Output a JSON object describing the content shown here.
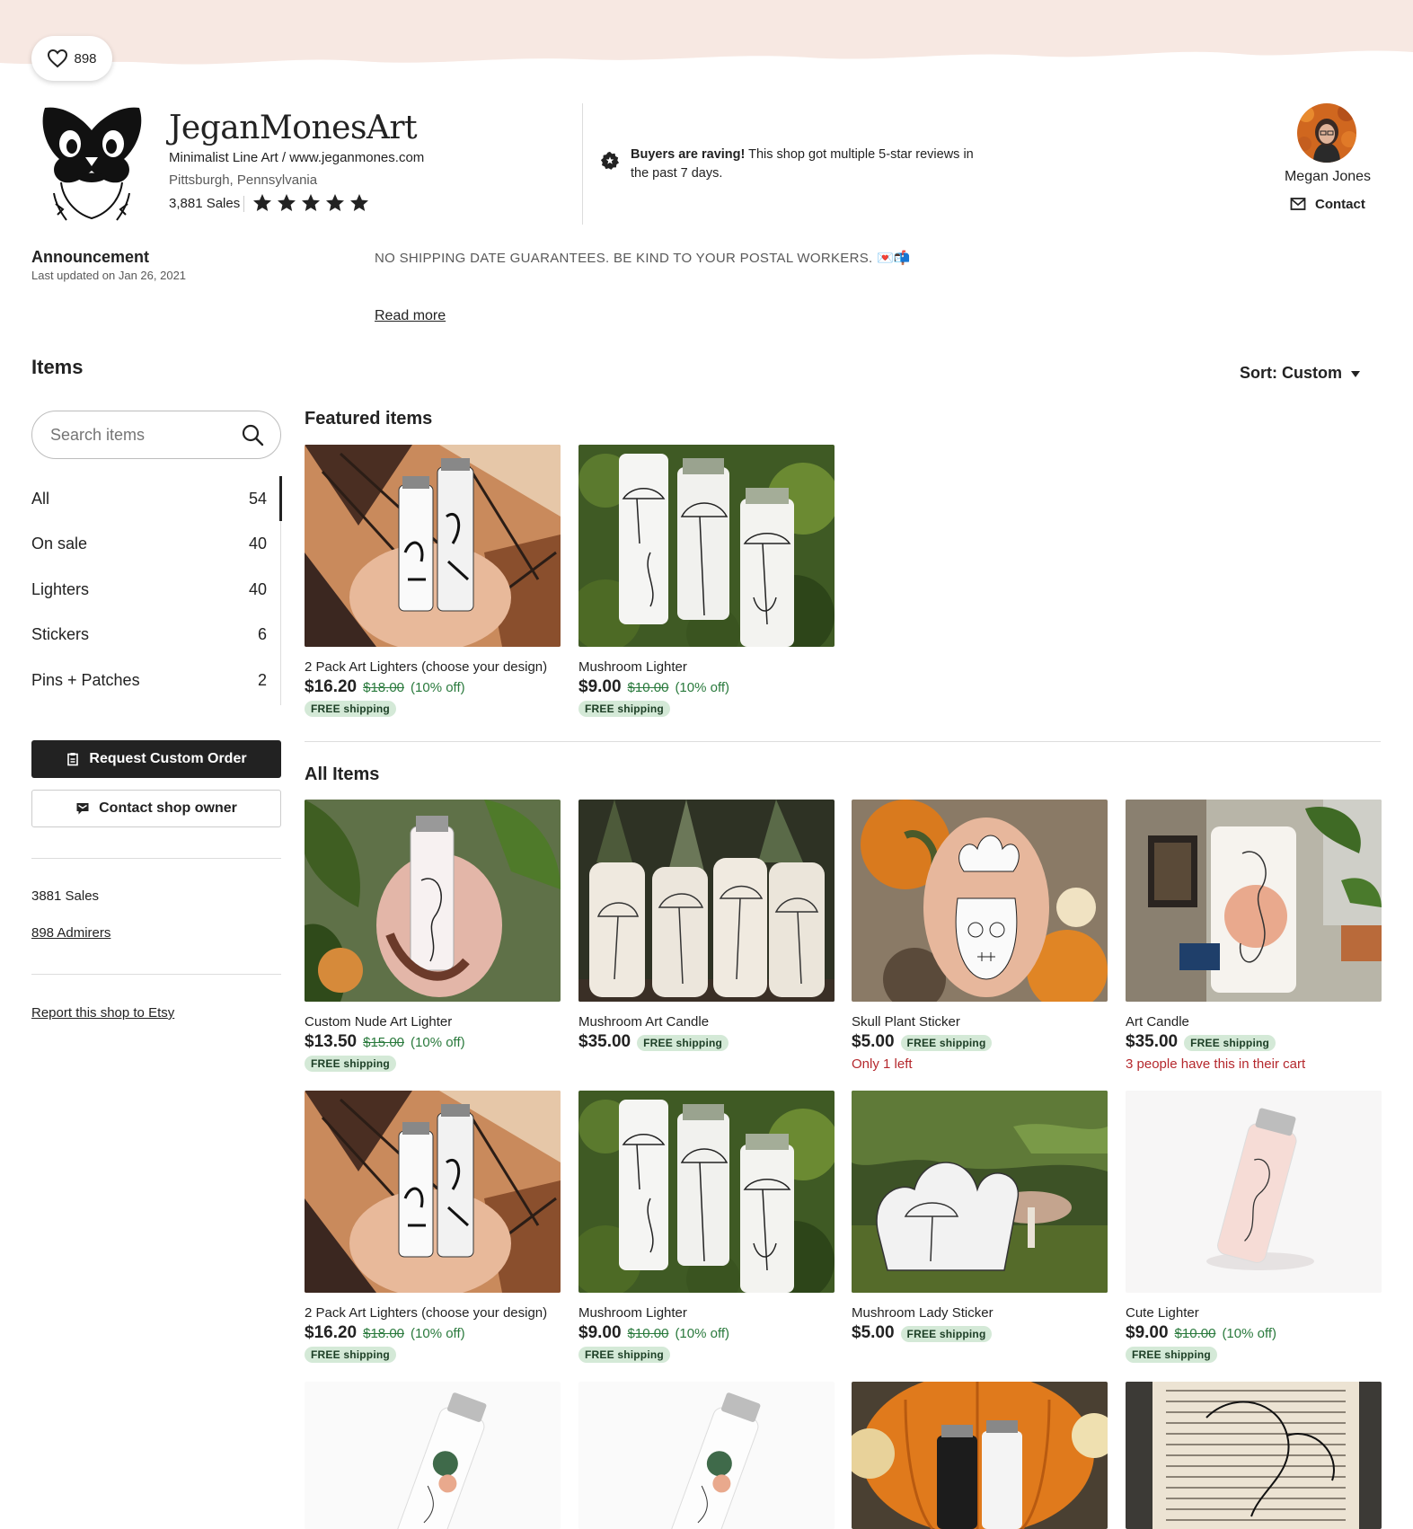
{
  "colors": {
    "banner": "#f7e8e2",
    "accent_dark": "#222222",
    "sale_green": "#2a7a3d",
    "ship_badge_bg": "#d4e9d7",
    "urgency_red": "#b5282d"
  },
  "favorites": {
    "count": "898",
    "icon": "heart-icon"
  },
  "shop": {
    "name": "JeganMonesArt",
    "tagline": "Minimalist Line Art / www.jeganmones.com",
    "location": "Pittsburgh, Pennsylvania",
    "sales": "3,881 Sales",
    "rating_stars": 5
  },
  "raving": {
    "bold": "Buyers are raving!",
    "text": " This shop got multiple 5-star reviews in the past 7 days."
  },
  "owner": {
    "name": "Megan Jones",
    "contact_label": "Contact"
  },
  "announcement": {
    "title": "Announcement",
    "updated": "Last updated on Jan 26, 2021",
    "text": "NO SHIPPING DATE GUARANTEES. BE KIND TO YOUR POSTAL WORKERS. 💌📬",
    "read_more": "Read more"
  },
  "items_heading": "Items",
  "sort_label": "Sort: Custom",
  "search": {
    "placeholder": "Search items"
  },
  "categories": [
    {
      "label": "All",
      "count": "54"
    },
    {
      "label": "On sale",
      "count": "40"
    },
    {
      "label": "Lighters",
      "count": "40"
    },
    {
      "label": "Stickers",
      "count": "6"
    },
    {
      "label": "Pins + Patches",
      "count": "2"
    }
  ],
  "sidebar": {
    "request_custom": "Request Custom Order",
    "contact_owner": "Contact shop owner",
    "sales": "3881 Sales",
    "admirers": "898 Admirers",
    "report": "Report this shop to Etsy"
  },
  "featured": {
    "title": "Featured items",
    "items": [
      {
        "title": "2 Pack Art Lighters (choose your design)",
        "price": "$16.20",
        "orig": "$18.00",
        "pct": "(10% off)",
        "ship": "FREE shipping"
      },
      {
        "title": "Mushroom Lighter",
        "price": "$9.00",
        "orig": "$10.00",
        "pct": "(10% off)",
        "ship": "FREE shipping"
      }
    ]
  },
  "all_items": {
    "title": "All Items",
    "items": [
      {
        "title": "Custom Nude Art Lighter",
        "price": "$13.50",
        "orig": "$15.00",
        "pct": "(10% off)",
        "ship": "FREE shipping"
      },
      {
        "title": "Mushroom Art Candle",
        "price": "$35.00",
        "ship": "FREE shipping"
      },
      {
        "title": "Skull Plant Sticker",
        "price": "$5.00",
        "ship": "FREE shipping",
        "note": "Only 1 left"
      },
      {
        "title": "Art Candle",
        "price": "$35.00",
        "ship": "FREE shipping",
        "note": "3 people have this in their cart"
      },
      {
        "title": "2 Pack Art Lighters (choose your design)",
        "price": "$16.20",
        "orig": "$18.00",
        "pct": "(10% off)",
        "ship": "FREE shipping"
      },
      {
        "title": "Mushroom Lighter",
        "price": "$9.00",
        "orig": "$10.00",
        "pct": "(10% off)",
        "ship": "FREE shipping"
      },
      {
        "title": "Mushroom Lady Sticker",
        "price": "$5.00",
        "ship": "FREE shipping"
      },
      {
        "title": "Cute Lighter",
        "price": "$9.00",
        "orig": "$10.00",
        "pct": "(10% off)",
        "ship": "FREE shipping"
      }
    ]
  }
}
